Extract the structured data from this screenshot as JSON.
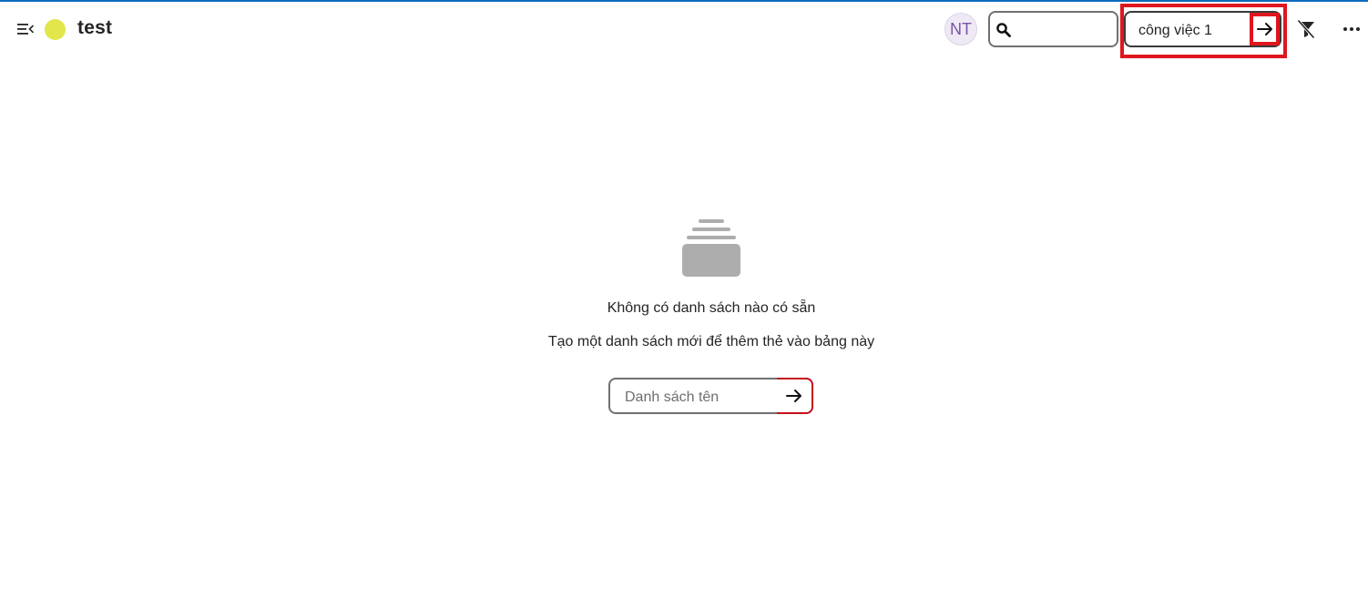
{
  "header": {
    "board_title": "test",
    "board_dot_color": "#e2e64a",
    "avatar_initials": "NT",
    "search": {
      "value": "",
      "placeholder": ""
    },
    "task_input": {
      "value": "công việc 1"
    },
    "icons": {
      "menu": "collapse-menu-icon",
      "search": "search-icon",
      "submit": "arrow-right-icon",
      "filter": "filter-off-icon",
      "more": "more-horizontal-icon"
    }
  },
  "empty_state": {
    "title": "Không có danh sách nào có sẵn",
    "subtitle": "Tạo một danh sách mới để thêm thẻ vào bảng này",
    "list_name_placeholder": "Danh sách tên",
    "illustration": "stacked-cards-icon"
  },
  "colors": {
    "accent": "#0f6cbd",
    "highlight": "#e0161e",
    "illustration": "#adadad"
  }
}
